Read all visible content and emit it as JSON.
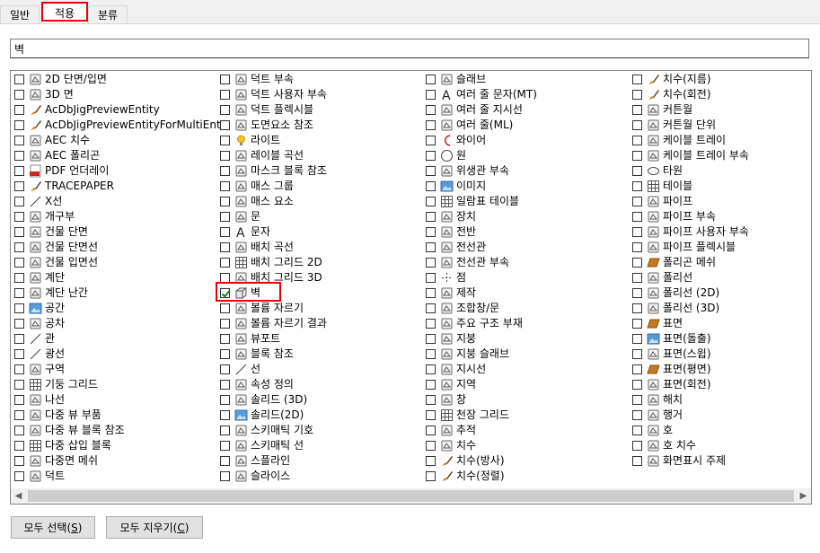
{
  "tabs": [
    {
      "label": "일반",
      "active": false
    },
    {
      "label": "적용",
      "active": true
    },
    {
      "label": "분류",
      "active": false
    }
  ],
  "search": {
    "value": "벽",
    "placeholder": ""
  },
  "columns": [
    [
      {
        "label": "2D 단면/입면",
        "icon": "house-section-icon",
        "checked": false
      },
      {
        "label": "3D 면",
        "icon": "3d-face-icon",
        "checked": false
      },
      {
        "label": "AcDbJigPreviewEntity",
        "icon": "brush-icon",
        "checked": false
      },
      {
        "label": "AcDbJigPreviewEntityForMultiEnts",
        "icon": "brush-icon",
        "checked": false
      },
      {
        "label": "AEC 치수",
        "icon": "aec-dimension-icon",
        "checked": false
      },
      {
        "label": "AEC 폴리곤",
        "icon": "polygon-icon",
        "checked": false
      },
      {
        "label": "PDF 언더레이",
        "icon": "pdf-icon",
        "checked": false
      },
      {
        "label": "TRACEPAPER",
        "icon": "brush-icon",
        "checked": false
      },
      {
        "label": "X선",
        "icon": "xline-icon",
        "checked": false
      },
      {
        "label": "개구부",
        "icon": "opening-icon",
        "checked": false
      },
      {
        "label": "건물 단면",
        "icon": "building-section-icon",
        "checked": false
      },
      {
        "label": "건물 단면선",
        "icon": "section-line-icon",
        "checked": false
      },
      {
        "label": "건물 입면선",
        "icon": "elevation-line-icon",
        "checked": false
      },
      {
        "label": "계단",
        "icon": "stair-icon",
        "checked": false
      },
      {
        "label": "계단 난간",
        "icon": "railing-icon",
        "checked": false
      },
      {
        "label": "공간",
        "icon": "space-icon",
        "checked": false
      },
      {
        "label": "공차",
        "icon": "tolerance-icon",
        "checked": false
      },
      {
        "label": "관",
        "icon": "pipe-line-icon",
        "checked": false
      },
      {
        "label": "광선",
        "icon": "ray-icon",
        "checked": false
      },
      {
        "label": "구역",
        "icon": "zone-icon",
        "checked": false
      },
      {
        "label": "기둥 그리드",
        "icon": "column-grid-icon",
        "checked": false
      },
      {
        "label": "나선",
        "icon": "helix-icon",
        "checked": false
      },
      {
        "label": "다중 뷰 부품",
        "icon": "multiview-part-icon",
        "checked": false
      },
      {
        "label": "다중 뷰 블록 참조",
        "icon": "multiview-block-icon",
        "checked": false
      },
      {
        "label": "다중 삽입 블록",
        "icon": "minsert-block-icon",
        "checked": false
      },
      {
        "label": "다중면 메쉬",
        "icon": "polyface-mesh-icon",
        "checked": false
      },
      {
        "label": "덕트",
        "icon": "duct-icon",
        "checked": false
      }
    ],
    [
      {
        "label": "덕트 부속",
        "icon": "duct-fitting-icon",
        "checked": false
      },
      {
        "label": "덕트 사용자 부속",
        "icon": "duct-custom-icon",
        "checked": false
      },
      {
        "label": "덕트 플렉시블",
        "icon": "duct-flex-icon",
        "checked": false
      },
      {
        "label": "도면요소 참조",
        "icon": "element-ref-icon",
        "checked": false
      },
      {
        "label": "라이트",
        "icon": "light-bulb-icon",
        "checked": false
      },
      {
        "label": "레이블 곡선",
        "icon": "label-curve-icon",
        "checked": false
      },
      {
        "label": "마스크 블록 참조",
        "icon": "mask-block-icon",
        "checked": false
      },
      {
        "label": "매스 그룹",
        "icon": "mass-group-icon",
        "checked": false
      },
      {
        "label": "매스 요소",
        "icon": "mass-element-icon",
        "checked": false
      },
      {
        "label": "문",
        "icon": "door-icon",
        "checked": false
      },
      {
        "label": "문자",
        "icon": "text-a-icon",
        "checked": false
      },
      {
        "label": "배치 곡선",
        "icon": "layout-curve-icon",
        "checked": false
      },
      {
        "label": "배치 그리드 2D",
        "icon": "layout-grid-2d-icon",
        "checked": false
      },
      {
        "label": "배치 그리드 3D",
        "icon": "layout-grid-3d-icon",
        "checked": false
      },
      {
        "label": "벽",
        "icon": "wall-icon",
        "checked": true
      },
      {
        "label": "볼륨 자르기",
        "icon": "volume-clip-icon",
        "checked": false
      },
      {
        "label": "볼륨 자르기 결과",
        "icon": "volume-clip-result-icon",
        "checked": false
      },
      {
        "label": "뷰포트",
        "icon": "viewport-icon",
        "checked": false
      },
      {
        "label": "블록 참조",
        "icon": "block-ref-icon",
        "checked": false
      },
      {
        "label": "선",
        "icon": "line-icon",
        "checked": false
      },
      {
        "label": "속성 정의",
        "icon": "attribute-def-icon",
        "checked": false
      },
      {
        "label": "솔리드 (3D)",
        "icon": "solid-3d-icon",
        "checked": false
      },
      {
        "label": "솔리드(2D)",
        "icon": "solid-2d-icon",
        "checked": false
      },
      {
        "label": "스키매틱 기호",
        "icon": "schematic-symbol-icon",
        "checked": false
      },
      {
        "label": "스키매틱 선",
        "icon": "schematic-line-icon",
        "checked": false
      },
      {
        "label": "스플라인",
        "icon": "spline-icon",
        "checked": false
      },
      {
        "label": "슬라이스",
        "icon": "slice-icon",
        "checked": false
      }
    ],
    [
      {
        "label": "슬래브",
        "icon": "slab-icon",
        "checked": false
      },
      {
        "label": "여러 줄 문자(MT)",
        "icon": "mtext-icon",
        "checked": false
      },
      {
        "label": "여러 줄 지시선",
        "icon": "mleader-icon",
        "checked": false
      },
      {
        "label": "여러 줄(ML)",
        "icon": "mline-icon",
        "checked": false
      },
      {
        "label": "와이어",
        "icon": "wire-icon",
        "checked": false
      },
      {
        "label": "원",
        "icon": "circle-icon",
        "checked": false
      },
      {
        "label": "위생관 부속",
        "icon": "plumbing-fitting-icon",
        "checked": false
      },
      {
        "label": "이미지",
        "icon": "image-icon",
        "checked": false
      },
      {
        "label": "일람표 테이블",
        "icon": "schedule-table-icon",
        "checked": false
      },
      {
        "label": "장치",
        "icon": "device-icon",
        "checked": false
      },
      {
        "label": "전반",
        "icon": "panel-icon",
        "checked": false
      },
      {
        "label": "전선관",
        "icon": "conduit-icon",
        "checked": false
      },
      {
        "label": "전선관 부속",
        "icon": "conduit-fitting-icon",
        "checked": false
      },
      {
        "label": "점",
        "icon": "point-icon",
        "checked": false
      },
      {
        "label": "제작",
        "icon": "fabrication-icon",
        "checked": false
      },
      {
        "label": "조합창/문",
        "icon": "window-assembly-icon",
        "checked": false
      },
      {
        "label": "주요 구조 부재",
        "icon": "structural-member-icon",
        "checked": false
      },
      {
        "label": "지붕",
        "icon": "roof-icon",
        "checked": false
      },
      {
        "label": "지붕 슬래브",
        "icon": "roof-slab-icon",
        "checked": false
      },
      {
        "label": "지시선",
        "icon": "leader-icon",
        "checked": false
      },
      {
        "label": "지역",
        "icon": "region-icon",
        "checked": false
      },
      {
        "label": "창",
        "icon": "window-icon",
        "checked": false
      },
      {
        "label": "천장 그리드",
        "icon": "ceiling-grid-icon",
        "checked": false
      },
      {
        "label": "추적",
        "icon": "trace-icon",
        "checked": false
      },
      {
        "label": "치수",
        "icon": "dimension-icon",
        "checked": false
      },
      {
        "label": "치수(방사)",
        "icon": "brush-icon",
        "checked": false
      },
      {
        "label": "치수(정렬)",
        "icon": "brush-icon",
        "checked": false
      }
    ],
    [
      {
        "label": "치수(지름)",
        "icon": "brush-icon",
        "checked": false
      },
      {
        "label": "치수(회전)",
        "icon": "brush-icon",
        "checked": false
      },
      {
        "label": "커튼월",
        "icon": "curtain-wall-icon",
        "checked": false
      },
      {
        "label": "커튼월 단위",
        "icon": "curtain-wall-unit-icon",
        "checked": false
      },
      {
        "label": "케이블 트레이",
        "icon": "cable-tray-icon",
        "checked": false
      },
      {
        "label": "케이블 트레이 부속",
        "icon": "cable-tray-fitting-icon",
        "checked": false
      },
      {
        "label": "타원",
        "icon": "ellipse-icon",
        "checked": false
      },
      {
        "label": "테이블",
        "icon": "table-icon",
        "checked": false
      },
      {
        "label": "파이프",
        "icon": "pipe-icon",
        "checked": false
      },
      {
        "label": "파이프 부속",
        "icon": "pipe-fitting-icon",
        "checked": false
      },
      {
        "label": "파이프 사용자 부속",
        "icon": "pipe-custom-icon",
        "checked": false
      },
      {
        "label": "파이프 플렉시블",
        "icon": "pipe-flex-icon",
        "checked": false
      },
      {
        "label": "폴리곤 메쉬",
        "icon": "polygon-mesh-icon",
        "checked": false
      },
      {
        "label": "폴리선",
        "icon": "polyline-icon",
        "checked": false
      },
      {
        "label": "폴리선 (2D)",
        "icon": "polyline-2d-icon",
        "checked": false
      },
      {
        "label": "폴리선 (3D)",
        "icon": "polyline-3d-icon",
        "checked": false
      },
      {
        "label": "표면",
        "icon": "surface-icon",
        "checked": false
      },
      {
        "label": "표면(돌출)",
        "icon": "surface-extrude-icon",
        "checked": false
      },
      {
        "label": "표면(스윕)",
        "icon": "surface-sweep-icon",
        "checked": false
      },
      {
        "label": "표면(평면)",
        "icon": "surface-planar-icon",
        "checked": false
      },
      {
        "label": "표면(회전)",
        "icon": "surface-revolve-icon",
        "checked": false
      },
      {
        "label": "해치",
        "icon": "hatch-icon",
        "checked": false
      },
      {
        "label": "행거",
        "icon": "hanger-icon",
        "checked": false
      },
      {
        "label": "호",
        "icon": "arc-icon",
        "checked": false
      },
      {
        "label": "호 치수",
        "icon": "arc-dimension-icon",
        "checked": false
      },
      {
        "label": "화면표시 주제",
        "icon": "display-theme-icon",
        "checked": false
      }
    ]
  ],
  "buttons": {
    "select_all": "모두 선택(",
    "select_all_key": "S",
    "select_all_end": ")",
    "clear_all": "모두 지우기(",
    "clear_all_key": "C",
    "clear_all_end": ")"
  },
  "colors": {
    "highlight": "#e8000b",
    "icon_blue": "#2f6db5",
    "icon_orange": "#c8781e",
    "check_green": "#1a7f1a"
  }
}
